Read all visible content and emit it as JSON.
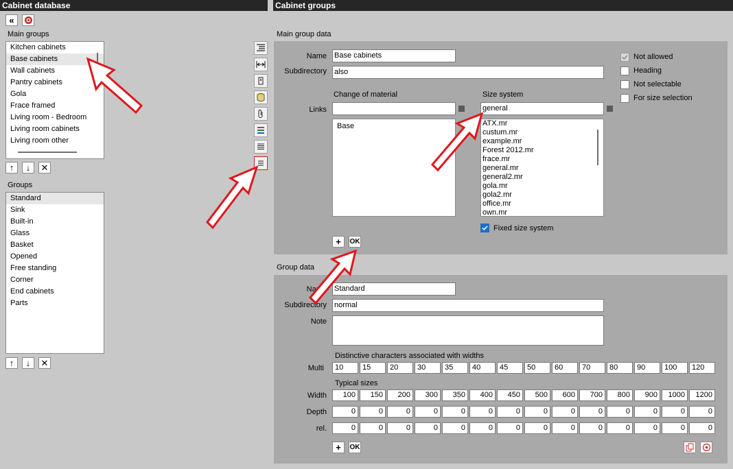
{
  "left": {
    "title": "Cabinet database",
    "toolbar": {
      "collapse_icon": "double-chevron-left-icon",
      "close_icon": "lifebuoy-icon"
    },
    "main_groups": {
      "label": "Main groups",
      "items": [
        "Kitchen cabinets",
        "Base cabinets",
        "Wall cabinets",
        "Pantry cabinets",
        "Gola",
        "Frace framed",
        "Living room - Bedroom",
        "Living room cabinets",
        "Living room other"
      ],
      "selected": "Base cabinets"
    },
    "groups": {
      "label": "Groups",
      "items": [
        "Standard",
        "Sink",
        "Built-in",
        "Glass",
        "Basket",
        "Opened",
        "Free standing",
        "Corner",
        "End cabinets",
        "Parts"
      ],
      "selected": "Standard"
    },
    "list_buttons": {
      "up": "↑",
      "down": "↓",
      "delete": "✕"
    }
  },
  "right": {
    "title": "Cabinet groups",
    "side_icons": [
      "list-indent-icon",
      "width-arrows-icon",
      "door-handle-icon",
      "database-stack-icon",
      "paperclip-icon",
      "color-bars-icon",
      "lines-list-icon",
      "text-lines-icon"
    ],
    "main_group_data": {
      "section_label": "Main group data",
      "name_label": "Name",
      "name_value": "Base cabinets",
      "subdirectory_label": "Subdirectory",
      "subdirectory_value": "also",
      "checkboxes": [
        {
          "label": "Not allowed",
          "checked": true,
          "disabled": true
        },
        {
          "label": "Heading",
          "checked": false
        },
        {
          "label": "Not selectable",
          "checked": false
        },
        {
          "label": "For size selection",
          "checked": false
        }
      ],
      "change_material_label": "Change of material",
      "size_system_label": "Size system",
      "links_label": "Links",
      "links_value": "",
      "size_system_value": "general",
      "links_list": [
        "Base"
      ],
      "size_files": [
        "ATX.mr",
        "custum.mr",
        "example.mr",
        "Forest 2012.mr",
        "frace.mr",
        "general.mr",
        "general2.mr",
        "gola.mr",
        "gola2.mr",
        "office.mr",
        "own.mr"
      ],
      "fixed_size_label": "Fixed size system",
      "fixed_size_checked": true,
      "add_label": "+",
      "ok_label": "OK"
    },
    "group_data": {
      "section_label": "Group data",
      "name_label": "Name",
      "name_value": "Standard",
      "subdirectory_label": "Subdirectory",
      "subdirectory_value": "normal",
      "note_label": "Note",
      "note_value": "",
      "distinctive_label": "Distinctive characters associated with widths",
      "multi_label": "Multi",
      "multi_values": [
        "10",
        "15",
        "20",
        "30",
        "35",
        "40",
        "45",
        "50",
        "60",
        "70",
        "80",
        "90",
        "100",
        "120"
      ],
      "typical_label": "Typical sizes",
      "width_label": "Width",
      "width_values": [
        "100",
        "150",
        "200",
        "300",
        "350",
        "400",
        "450",
        "500",
        "600",
        "700",
        "800",
        "900",
        "1000",
        "1200"
      ],
      "depth_label": "Depth",
      "depth_values": [
        "0",
        "0",
        "0",
        "0",
        "0",
        "0",
        "0",
        "0",
        "0",
        "0",
        "0",
        "0",
        "0",
        "0"
      ],
      "rel_label": "rel.",
      "rel_values": [
        "0",
        "0",
        "0",
        "0",
        "0",
        "0",
        "0",
        "0",
        "0",
        "0",
        "0",
        "0",
        "0",
        "0"
      ],
      "add_label": "+",
      "ok_label": "OK",
      "copy_icon": "copy-icon",
      "target_icon": "target-icon"
    }
  },
  "colors": {
    "titlebar": "#262626",
    "panel": "#a9a9a9",
    "background": "#c8c8c8",
    "arrow": "#e0161d",
    "check": "#1a6fc9"
  }
}
